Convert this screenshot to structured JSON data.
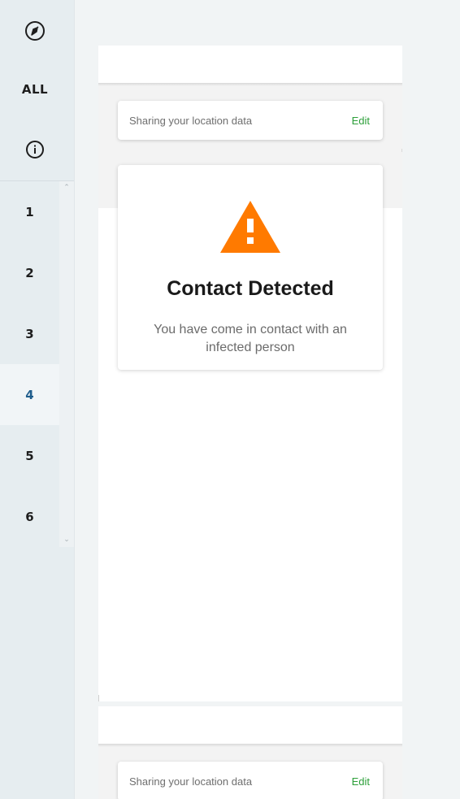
{
  "sidebar": {
    "top_buttons": [
      {
        "name": "pointer-icon"
      },
      {
        "label": "ALL"
      },
      {
        "name": "info-icon"
      }
    ],
    "pages": [
      "1",
      "2",
      "3",
      "4",
      "5",
      "6"
    ],
    "active_page": "4"
  },
  "frame1": {
    "share_text": "Sharing your location data",
    "share_action": "Edit",
    "alert_title": "Contact Detected",
    "alert_body": "You have come in contact with an infected person",
    "alert_color": "#ff7a00"
  },
  "frame2": {
    "share_text": "Sharing your location data",
    "share_action": "Edit"
  }
}
